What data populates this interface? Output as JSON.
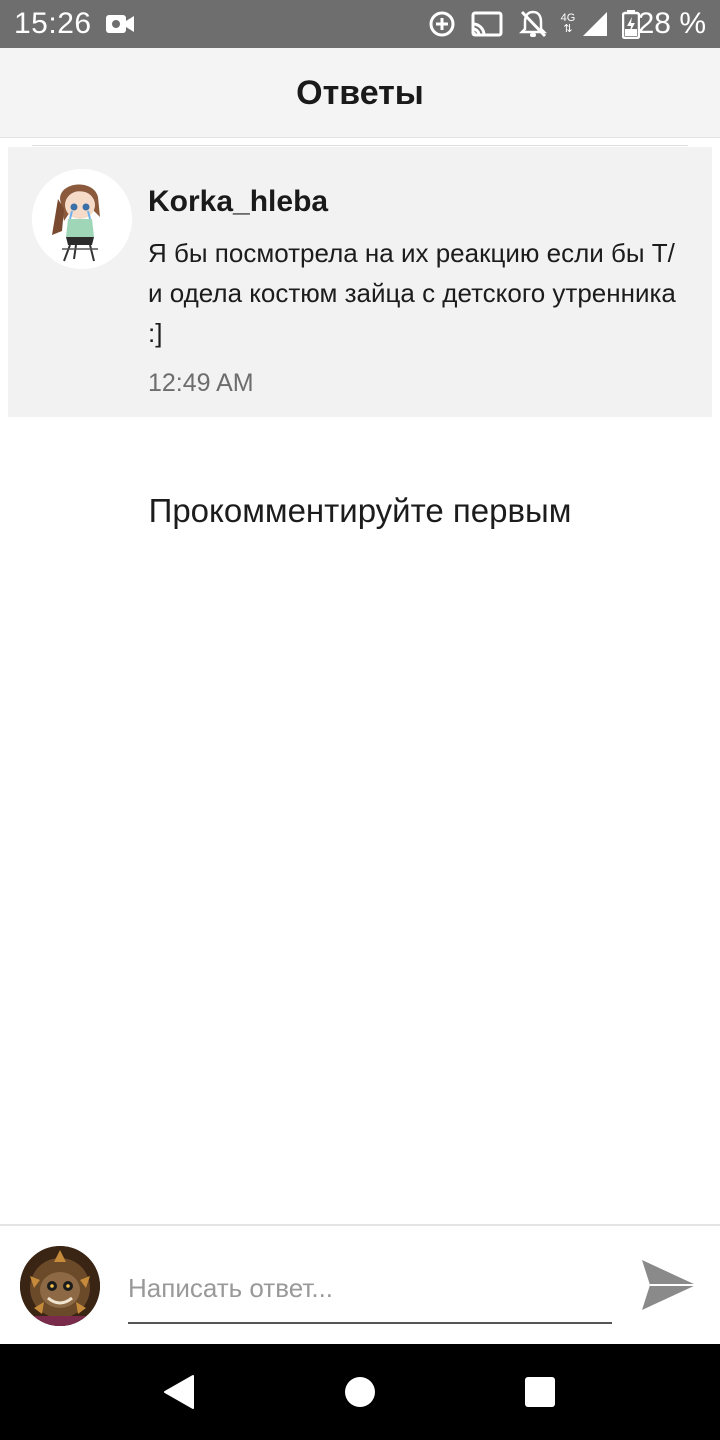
{
  "status_bar": {
    "time": "15:26",
    "battery": "28 %",
    "network": "4G",
    "icons": [
      "video-recording-icon",
      "data-saver-icon",
      "cast-icon",
      "notifications-off-icon",
      "signal-icon",
      "battery-icon"
    ]
  },
  "header": {
    "title": "Ответы"
  },
  "comment": {
    "author": "Korka_hleba",
    "text": "Я бы посмотрела на их реакцию если бы Т/и одела костюм зайца с детского утренника :]",
    "time": "12:49 AM"
  },
  "empty_state": {
    "text": "Прокомментируйте первым"
  },
  "reply": {
    "placeholder": "Написать ответ...",
    "value": ""
  },
  "nav": {
    "buttons": [
      "back-icon",
      "home-icon",
      "recents-icon"
    ]
  },
  "colors": {
    "status_bar_bg": "#6e6e6e",
    "header_bg": "#f4f4f4",
    "card_bg": "#f2f2f2",
    "send_icon": "#8a8a8a",
    "nav_bg": "#000000"
  }
}
